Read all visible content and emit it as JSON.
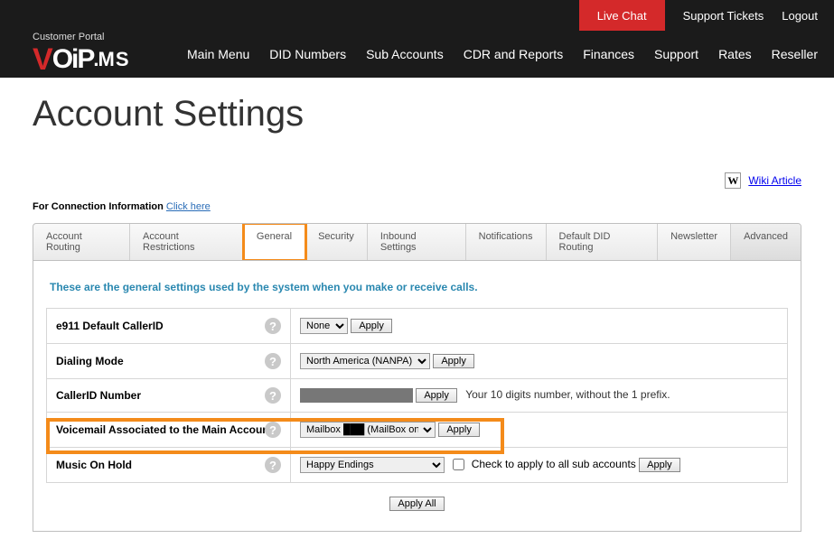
{
  "top_links": {
    "live_chat": "Live Chat",
    "tickets": "Support Tickets",
    "logout": "Logout"
  },
  "brand_sub": "Customer Portal",
  "nav": {
    "main": "Main Menu",
    "did": "DID Numbers",
    "sub": "Sub Accounts",
    "cdr": "CDR and Reports",
    "fin": "Finances",
    "support": "Support",
    "rates": "Rates",
    "reseller": "Reseller"
  },
  "page_title": "Account Settings",
  "wiki_label": "Wiki Article",
  "conn_line_prefix": "For Connection Information ",
  "conn_line_link": "Click here",
  "tabs": {
    "routing": "Account Routing",
    "restrictions": "Account Restrictions",
    "general": "General",
    "security": "Security",
    "inbound": "Inbound Settings",
    "notifications": "Notifications",
    "didrouting": "Default DID Routing",
    "newsletter": "Newsletter",
    "advanced": "Advanced"
  },
  "introtext": "These are the general settings used by the system when you make or receive calls.",
  "rows": {
    "e911_label": "e911 Default CallerID",
    "e911_select": "None",
    "dialing_label": "Dialing Mode",
    "dialing_select": "North America (NANPA)",
    "cid_label": "CallerID Number",
    "cid_hint": "Your 10 digits number, without the 1 prefix.",
    "vm_label": "Voicemail Associated to the Main Account",
    "vm_select_prefix": "Mailbox",
    "vm_select_suffix": "(MailBox one)",
    "moh_label": "Music On Hold",
    "moh_select": "Happy Endings",
    "moh_checklabel": "Check to apply to all sub accounts"
  },
  "buttons": {
    "apply": "Apply",
    "apply_all": "Apply All"
  }
}
